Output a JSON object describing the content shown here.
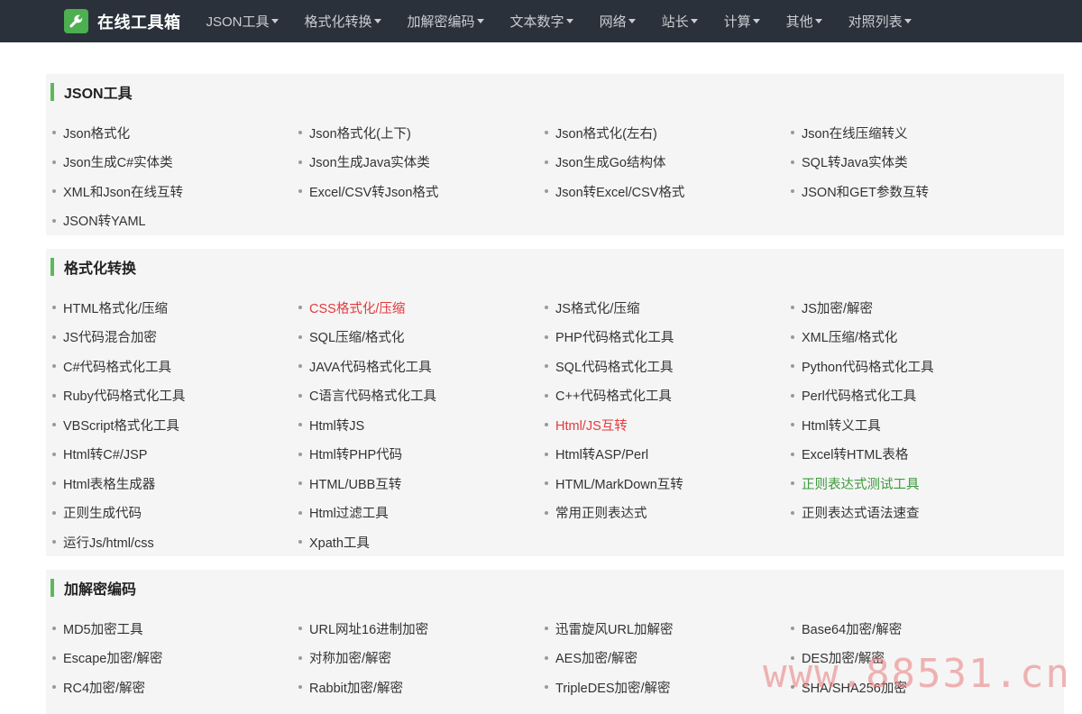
{
  "brand": {
    "title": "在线工具箱",
    "icon": "wrench-icon"
  },
  "nav": [
    "JSON工具",
    "格式化转换",
    "加解密编码",
    "文本数字",
    "网络",
    "站长",
    "计算",
    "其他",
    "对照列表"
  ],
  "sections": [
    {
      "title": "JSON工具",
      "items": [
        {
          "label": "Json格式化"
        },
        {
          "label": "Json格式化(上下)"
        },
        {
          "label": "Json格式化(左右)"
        },
        {
          "label": "Json在线压缩转义"
        },
        {
          "label": "Json生成C#实体类"
        },
        {
          "label": "Json生成Java实体类"
        },
        {
          "label": "Json生成Go结构体"
        },
        {
          "label": "SQL转Java实体类"
        },
        {
          "label": "XML和Json在线互转"
        },
        {
          "label": "Excel/CSV转Json格式"
        },
        {
          "label": "Json转Excel/CSV格式"
        },
        {
          "label": "JSON和GET参数互转"
        },
        {
          "label": "JSON转YAML"
        }
      ]
    },
    {
      "title": "格式化转换",
      "items": [
        {
          "label": "HTML格式化/压缩"
        },
        {
          "label": "CSS格式化/压缩",
          "color": "#e4393c"
        },
        {
          "label": "JS格式化/压缩"
        },
        {
          "label": "JS加密/解密"
        },
        {
          "label": "JS代码混合加密"
        },
        {
          "label": "SQL压缩/格式化"
        },
        {
          "label": "PHP代码格式化工具"
        },
        {
          "label": "XML压缩/格式化"
        },
        {
          "label": "C#代码格式化工具"
        },
        {
          "label": "JAVA代码格式化工具"
        },
        {
          "label": "SQL代码格式化工具"
        },
        {
          "label": "Python代码格式化工具"
        },
        {
          "label": "Ruby代码格式化工具"
        },
        {
          "label": "C语言代码格式化工具"
        },
        {
          "label": "C++代码格式化工具"
        },
        {
          "label": "Perl代码格式化工具"
        },
        {
          "label": "VBScript格式化工具"
        },
        {
          "label": "Html转JS"
        },
        {
          "label": "Html/JS互转",
          "color": "#e4393c"
        },
        {
          "label": "Html转义工具"
        },
        {
          "label": "Html转C#/JSP"
        },
        {
          "label": "Html转PHP代码"
        },
        {
          "label": "Html转ASP/Perl"
        },
        {
          "label": "Excel转HTML表格"
        },
        {
          "label": "Html表格生成器"
        },
        {
          "label": "HTML/UBB互转"
        },
        {
          "label": "HTML/MarkDown互转"
        },
        {
          "label": "正则表达式测试工具",
          "color": "#3c9a3c"
        },
        {
          "label": "正则生成代码"
        },
        {
          "label": "Html过滤工具"
        },
        {
          "label": "常用正则表达式"
        },
        {
          "label": "正则表达式语法速查"
        },
        {
          "label": "运行Js/html/css"
        },
        {
          "label": "Xpath工具"
        }
      ]
    },
    {
      "title": "加解密编码",
      "items": [
        {
          "label": "MD5加密工具"
        },
        {
          "label": "URL网址16进制加密"
        },
        {
          "label": "迅雷旋风URL加解密"
        },
        {
          "label": "Base64加密/解密"
        },
        {
          "label": "Escape加密/解密"
        },
        {
          "label": "对称加密/解密"
        },
        {
          "label": "AES加密/解密"
        },
        {
          "label": "DES加密/解密"
        },
        {
          "label": "RC4加密/解密"
        },
        {
          "label": "Rabbit加密/解密"
        },
        {
          "label": "TripleDES加密/解密"
        },
        {
          "label": "SHA/SHA256加密"
        }
      ]
    }
  ],
  "watermark": "www.88531.cn"
}
